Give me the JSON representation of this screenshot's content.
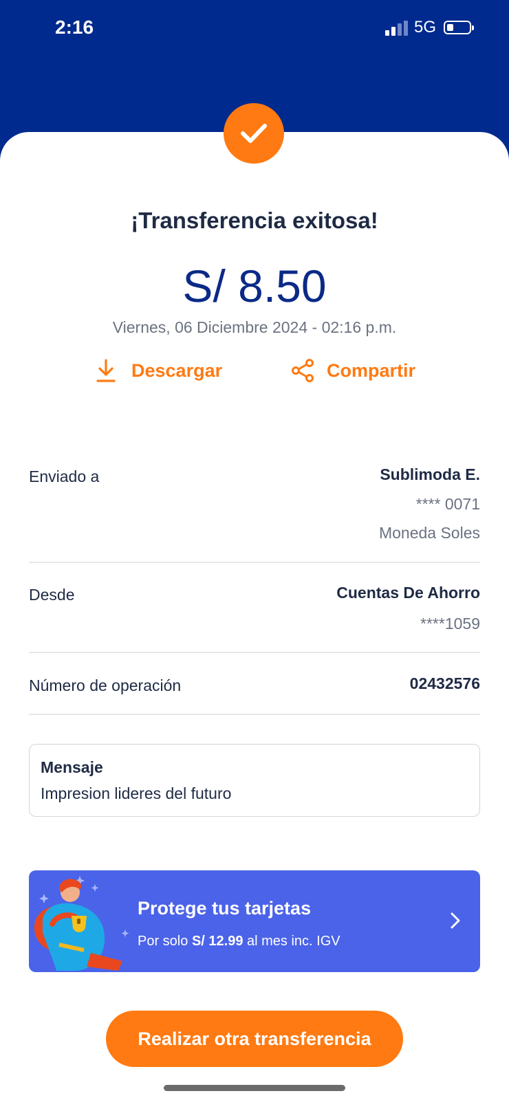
{
  "status_bar": {
    "time": "2:16",
    "network": "5G"
  },
  "receipt": {
    "title": "¡Transferencia exitosa!",
    "amount": "S/ 8.50",
    "datetime": "Viernes, 06 Diciembre 2024 - 02:16 p.m.",
    "actions": {
      "download_label": "Descargar",
      "share_label": "Compartir"
    }
  },
  "details": {
    "sent_to": {
      "label": "Enviado a",
      "name": "Sublimoda E.",
      "account": "**** 0071",
      "currency": "Moneda Soles"
    },
    "from": {
      "label": "Desde",
      "account_type": "Cuentas De Ahorro",
      "account": "****1059"
    },
    "operation": {
      "label": "Número de operación",
      "number": "02432576"
    }
  },
  "message": {
    "title": "Mensaje",
    "text": "Impresion lideres del futuro"
  },
  "promo": {
    "title": "Protege tus tarjetas",
    "subtitle_prefix": "Por solo",
    "price": "S/ 12.99",
    "subtitle_suffix": "al mes inc. IGV"
  },
  "cta": {
    "label": "Realizar otra transferencia"
  },
  "colors": {
    "brand_blue": "#002a8d",
    "accent_orange": "#ff7a12",
    "promo_blue": "#4b63e8"
  }
}
